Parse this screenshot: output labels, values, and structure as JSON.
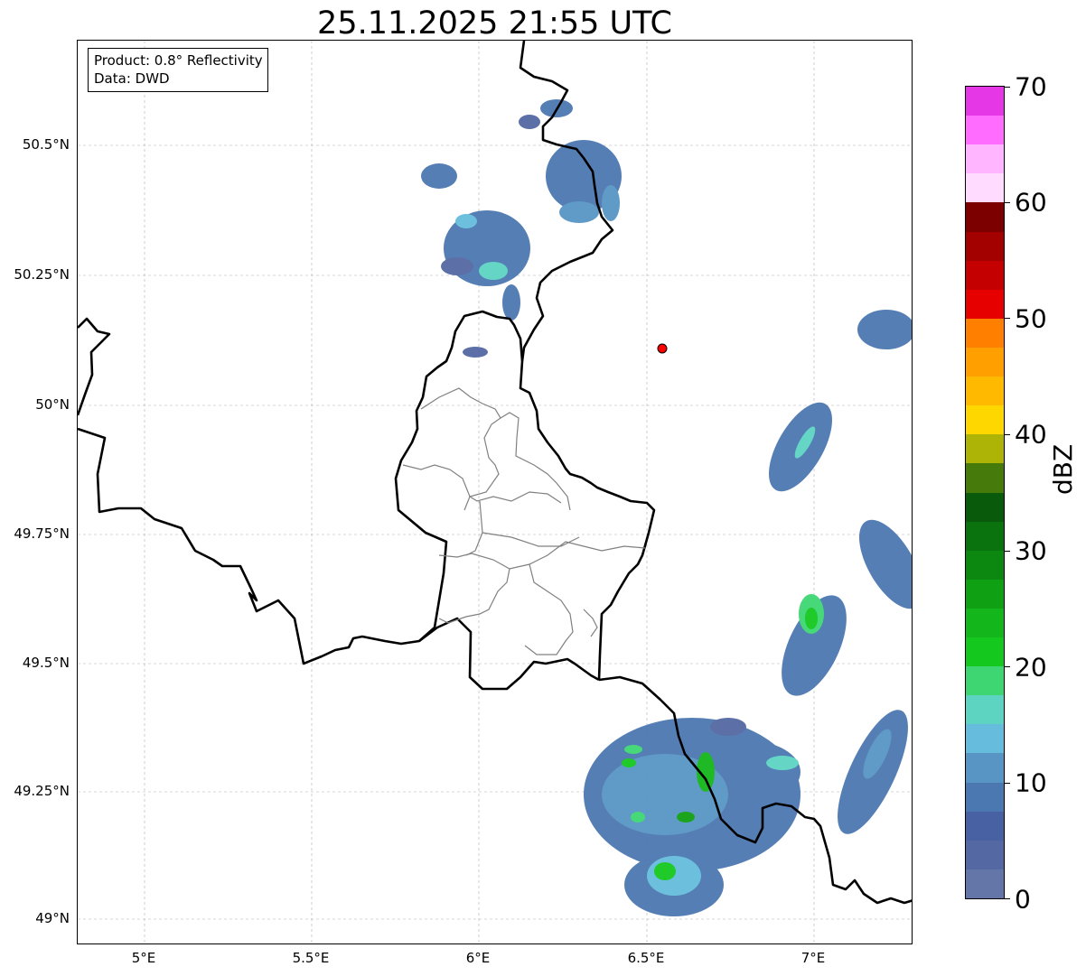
{
  "title": "25.11.2025 21:55 UTC",
  "info": {
    "line1": "Product: 0.8° Reflectivity",
    "line2": "Data: DWD"
  },
  "axes": {
    "x_ticks": [
      "5°E",
      "5.5°E",
      "6°E",
      "6.5°E",
      "7°E"
    ],
    "y_ticks": [
      "50.5°N",
      "50.25°N",
      "50°N",
      "49.75°N",
      "49.5°N",
      "49.25°N",
      "49°N"
    ]
  },
  "colorbar": {
    "label": "dBZ",
    "ticks": [
      "0",
      "10",
      "20",
      "30",
      "40",
      "50",
      "60",
      "70"
    ],
    "colors": [
      "#6475a8",
      "#5468a3",
      "#4761a2",
      "#4c78b1",
      "#5895c5",
      "#65bcdc",
      "#5dd4c2",
      "#3dd672",
      "#14c81e",
      "#13b61b",
      "#10a014",
      "#0c8710",
      "#0a730e",
      "#0a5a0c",
      "#467b0b",
      "#adb406",
      "#ffd700",
      "#ffba00",
      "#ff9f00",
      "#ff8000",
      "#e60000",
      "#c40000",
      "#a30000",
      "#7d0000",
      "#ffdcff",
      "#ffb5ff",
      "#ff6cff",
      "#e637e6"
    ]
  },
  "radar_site_marker": {
    "lon": 6.55,
    "lat": 50.11,
    "color": "#ff0000"
  },
  "map_colors": {
    "country_border": "#000000",
    "canton_border": "#808080",
    "grid": "#b0b0b0"
  }
}
